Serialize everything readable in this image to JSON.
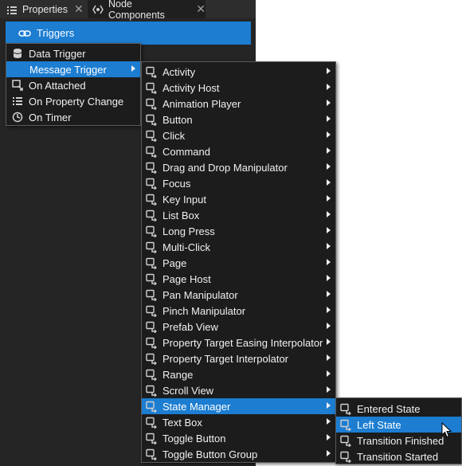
{
  "tabs": [
    {
      "label": "Properties",
      "icon": "list-icon",
      "closable": true,
      "active": false
    },
    {
      "label": "Node Components",
      "icon": "component-icon",
      "closable": true,
      "active": true
    }
  ],
  "triggers_button": {
    "label": "Triggers",
    "icon": "link-icon"
  },
  "trigger_menu": [
    {
      "label": "Data Trigger",
      "icon": "database-icon"
    },
    {
      "label": "Message Trigger",
      "icon": "message-icon",
      "submenu": true,
      "selected": true
    },
    {
      "label": "On Attached",
      "icon": "attach-icon"
    },
    {
      "label": "On Property Change",
      "icon": "property-list-icon"
    },
    {
      "label": "On Timer",
      "icon": "timer-icon"
    }
  ],
  "message_menu": [
    {
      "label": "Activity",
      "icon": "activity-icon"
    },
    {
      "label": "Activity Host",
      "icon": "activity-host-icon"
    },
    {
      "label": "Animation Player",
      "icon": "animation-icon"
    },
    {
      "label": "Button",
      "icon": "button-icon"
    },
    {
      "label": "Click",
      "icon": "click-icon"
    },
    {
      "label": "Command",
      "icon": "command-icon"
    },
    {
      "label": "Drag and Drop Manipulator",
      "icon": "move-icon"
    },
    {
      "label": "Focus",
      "icon": "focus-icon"
    },
    {
      "label": "Key Input",
      "icon": "key-icon"
    },
    {
      "label": "List Box",
      "icon": "list-box-icon"
    },
    {
      "label": "Long Press",
      "icon": "long-press-icon"
    },
    {
      "label": "Multi-Click",
      "icon": "multi-click-icon"
    },
    {
      "label": "Page",
      "icon": "page-icon"
    },
    {
      "label": "Page Host",
      "icon": "page-host-icon"
    },
    {
      "label": "Pan Manipulator",
      "icon": "pan-icon"
    },
    {
      "label": "Pinch Manipulator",
      "icon": "pinch-icon"
    },
    {
      "label": "Prefab View",
      "icon": "prefab-icon"
    },
    {
      "label": "Property Target Easing Interpolator",
      "icon": "easing-icon"
    },
    {
      "label": "Property Target Interpolator",
      "icon": "interpolator-icon"
    },
    {
      "label": "Range",
      "icon": "range-icon"
    },
    {
      "label": "Scroll View",
      "icon": "scroll-icon"
    },
    {
      "label": "State Manager",
      "icon": "state-manager-icon",
      "selected": true
    },
    {
      "label": "Text Box",
      "icon": "text-box-icon"
    },
    {
      "label": "Toggle Button",
      "icon": "toggle-icon"
    },
    {
      "label": "Toggle Button Group",
      "icon": "toggle-group-icon"
    }
  ],
  "state_manager_menu": [
    {
      "label": "Entered State",
      "icon": "state-icon"
    },
    {
      "label": "Left State",
      "icon": "state-icon",
      "selected": true
    },
    {
      "label": "Transition Finished",
      "icon": "state-icon"
    },
    {
      "label": "Transition Started",
      "icon": "state-icon"
    }
  ],
  "colors": {
    "accent": "#1c7dd1",
    "background": "#252525",
    "menu": "#1c1c1c"
  }
}
